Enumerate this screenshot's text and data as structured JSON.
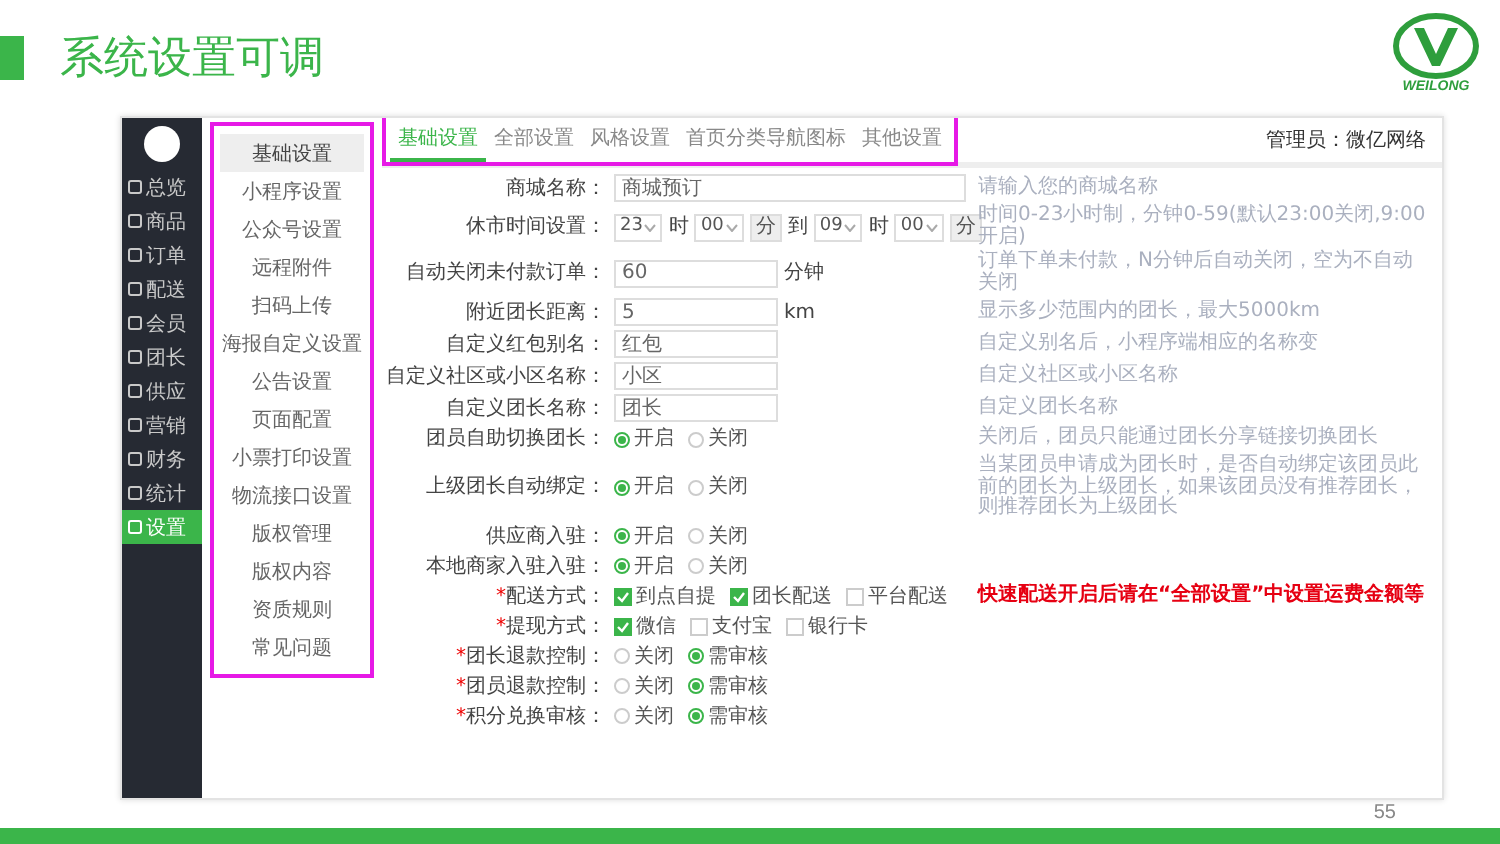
{
  "slide": {
    "title": "系统设置可调",
    "logo_text": "WEILONG",
    "page_number": "55"
  },
  "sidebar": {
    "items": [
      {
        "label": "总览",
        "selected": false
      },
      {
        "label": "商品",
        "selected": false
      },
      {
        "label": "订单",
        "selected": false
      },
      {
        "label": "配送",
        "selected": false
      },
      {
        "label": "会员",
        "selected": false
      },
      {
        "label": "团长",
        "selected": false
      },
      {
        "label": "供应",
        "selected": false
      },
      {
        "label": "营销",
        "selected": false
      },
      {
        "label": "财务",
        "selected": false
      },
      {
        "label": "统计",
        "selected": false
      },
      {
        "label": "设置",
        "selected": true
      }
    ]
  },
  "submenu": {
    "items": [
      {
        "label": "基础设置",
        "selected": true
      },
      {
        "label": "小程序设置",
        "selected": false
      },
      {
        "label": "公众号设置",
        "selected": false
      },
      {
        "label": "远程附件",
        "selected": false
      },
      {
        "label": "扫码上传",
        "selected": false
      },
      {
        "label": "海报自定义设置",
        "selected": false
      },
      {
        "label": "公告设置",
        "selected": false
      },
      {
        "label": "页面配置",
        "selected": false
      },
      {
        "label": "小票打印设置",
        "selected": false
      },
      {
        "label": "物流接口设置",
        "selected": false
      },
      {
        "label": "版权管理",
        "selected": false
      },
      {
        "label": "版权内容",
        "selected": false
      },
      {
        "label": "资质规则",
        "selected": false
      },
      {
        "label": "常见问题",
        "selected": false
      }
    ]
  },
  "tabs": [
    {
      "label": "基础设置",
      "selected": true
    },
    {
      "label": "全部设置",
      "selected": false
    },
    {
      "label": "风格设置",
      "selected": false
    },
    {
      "label": "首页分类导航图标",
      "selected": false
    },
    {
      "label": "其他设置",
      "selected": false
    }
  ],
  "admin": "管理员：微亿网络",
  "form": {
    "rows": [
      {
        "kind": "input",
        "label": "商城名称：",
        "value": "商城预订",
        "wide": true,
        "hint": "请输入您的商城名称"
      },
      {
        "kind": "time",
        "label": "休市时间设置：",
        "parts": [
          {
            "kind": "select",
            "text": "23"
          },
          {
            "kind": "text",
            "text": "时"
          },
          {
            "kind": "select",
            "text": "00"
          },
          {
            "kind": "addon",
            "text": "分"
          },
          {
            "kind": "text",
            "text": "到"
          },
          {
            "kind": "select",
            "text": "09"
          },
          {
            "kind": "text",
            "text": "时"
          },
          {
            "kind": "select",
            "text": "00"
          },
          {
            "kind": "addon",
            "text": "分"
          }
        ],
        "hint": "时间0-23小时制，分钟0-59(默认23:00关闭,9:00开启)"
      },
      {
        "kind": "input",
        "label": "自动关闭未付款订单：",
        "value": "60",
        "unit": "分钟",
        "hint": "订单下单未付款，N分钟后自动关闭，空为不自动关闭"
      },
      {
        "kind": "input",
        "label": "附近团长距离：",
        "value": "5",
        "unit": "km",
        "hint": "显示多少范围内的团长，最大5000km"
      },
      {
        "kind": "input",
        "label": "自定义红包别名：",
        "value": "红包",
        "hint": "自定义别名后，小程序端相应的名称变"
      },
      {
        "kind": "input",
        "label": "自定义社区或小区名称：",
        "value": "小区",
        "hint": "自定义社区或小区名称"
      },
      {
        "kind": "input",
        "label": "自定义团长名称：",
        "value": "团长",
        "hint": "自定义团长名称"
      },
      {
        "kind": "radio",
        "label": "团员自助切换团长：",
        "options": [
          {
            "label": "开启",
            "selected": true
          },
          {
            "label": "关闭",
            "selected": false
          }
        ],
        "hint": "关闭后，团员只能通过团长分享链接切换团长"
      },
      {
        "kind": "radio",
        "label": "上级团长自动绑定：",
        "options": [
          {
            "label": "开启",
            "selected": true
          },
          {
            "label": "关闭",
            "selected": false
          }
        ],
        "hint": "当某团员申请成为团长时，是否自动绑定该团员此前的团长为上级团长，如果该团员没有推荐团长，则推荐团长为上级团长"
      },
      {
        "kind": "radio",
        "label": "供应商入驻：",
        "options": [
          {
            "label": "开启",
            "selected": true
          },
          {
            "label": "关闭",
            "selected": false
          }
        ]
      },
      {
        "kind": "radio",
        "label": "本地商家入驻入驻：",
        "options": [
          {
            "label": "开启",
            "selected": true
          },
          {
            "label": "关闭",
            "selected": false
          }
        ]
      },
      {
        "kind": "checkbox",
        "mark": "*",
        "label": "配送方式：",
        "options": [
          {
            "label": "到点自提",
            "checked": true
          },
          {
            "label": "团长配送",
            "checked": true
          },
          {
            "label": "平台配送",
            "checked": false
          }
        ],
        "warning": "快速配送开启后请在“全部设置”中设置运费金额等"
      },
      {
        "kind": "checkbox",
        "mark": "*",
        "label": "提现方式：",
        "options": [
          {
            "label": "微信",
            "checked": true
          },
          {
            "label": "支付宝",
            "checked": false
          },
          {
            "label": "银行卡",
            "checked": false
          }
        ]
      },
      {
        "kind": "radio",
        "mark": "*",
        "label": "团长退款控制：",
        "options": [
          {
            "label": "关闭",
            "selected": false
          },
          {
            "label": "需审核",
            "selected": true
          }
        ]
      },
      {
        "kind": "radio",
        "mark": "*",
        "label": "团员退款控制：",
        "options": [
          {
            "label": "关闭",
            "selected": false
          },
          {
            "label": "需审核",
            "selected": true
          }
        ]
      },
      {
        "kind": "radio",
        "mark": "*",
        "label": "积分兑换审核：",
        "options": [
          {
            "label": "关闭",
            "selected": false
          },
          {
            "label": "需审核",
            "selected": true
          }
        ]
      }
    ]
  }
}
